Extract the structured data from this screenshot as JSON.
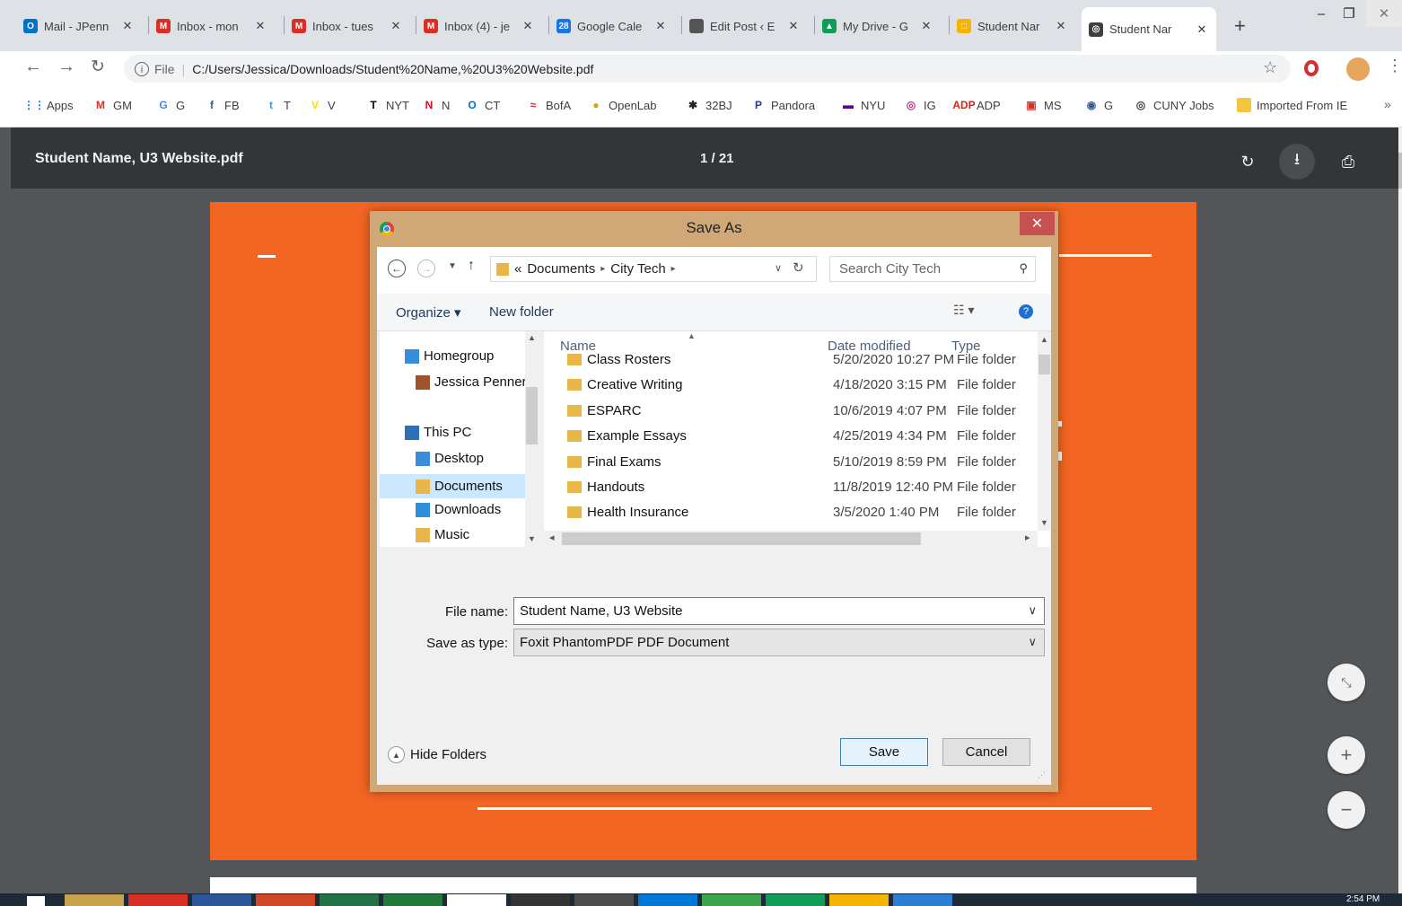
{
  "browser": {
    "tabs": [
      {
        "title": "Mail - JPenn",
        "icon": "outlook-icon",
        "color": "#0072c6",
        "letter": "O"
      },
      {
        "title": "Inbox - mon",
        "icon": "gmail-icon",
        "color": "#d93025",
        "letter": "M"
      },
      {
        "title": "Inbox - tues",
        "icon": "gmail-icon",
        "color": "#d93025",
        "letter": "M"
      },
      {
        "title": "Inbox (4) - je",
        "icon": "gmail-icon",
        "color": "#d93025",
        "letter": "M"
      },
      {
        "title": "Google Cale",
        "icon": "calendar-icon",
        "color": "#1a73e8",
        "letter": "28"
      },
      {
        "title": "Edit Post ‹ E",
        "icon": "image-icon",
        "color": "#555555",
        "letter": ""
      },
      {
        "title": "My Drive - G",
        "icon": "drive-icon",
        "color": "#0f9d58",
        "letter": "▲"
      },
      {
        "title": "Student Nar",
        "icon": "slides-icon",
        "color": "#f4b400",
        "letter": "□"
      },
      {
        "title": "Student Nar",
        "icon": "globe-icon",
        "color": "#3c4043",
        "letter": "◎"
      }
    ],
    "close_glyph": "✕",
    "new_tab": "+",
    "window": {
      "minimize": "–",
      "restore": "❐",
      "close": "✕"
    },
    "url_scheme": "File",
    "url": "C:/Users/Jessica/Downloads/Student%20Name,%20U3%20Website.pdf",
    "bookmarks": [
      {
        "label": "Apps",
        "icon": "apps-grid-icon",
        "color": "#1a73e8",
        "glyph": "⋮⋮"
      },
      {
        "label": "GM",
        "icon": "gmail-icon",
        "color": "#d93025",
        "glyph": "M"
      },
      {
        "label": "G",
        "icon": "google-icon",
        "color": "#4285f4",
        "glyph": "G"
      },
      {
        "label": "FB",
        "icon": "facebook-icon",
        "color": "#3b5998",
        "glyph": "f"
      },
      {
        "label": "T",
        "icon": "twitter-icon",
        "color": "#1da1f2",
        "glyph": "t"
      },
      {
        "label": "V",
        "icon": "vice-icon",
        "color": "#f5e000",
        "glyph": "V"
      },
      {
        "label": "NYT",
        "icon": "nyt-icon",
        "color": "#000000",
        "glyph": "T"
      },
      {
        "label": "N",
        "icon": "netflix-icon",
        "color": "#e50914",
        "glyph": "N"
      },
      {
        "label": "CT",
        "icon": "outlook-icon",
        "color": "#0072c6",
        "glyph": "O"
      },
      {
        "label": "BofA",
        "icon": "bofa-icon",
        "color": "#e31837",
        "glyph": "≈"
      },
      {
        "label": "OpenLab",
        "icon": "openlab-icon",
        "color": "#d4a017",
        "glyph": "●"
      },
      {
        "label": "32BJ",
        "icon": "union-icon",
        "color": "#222222",
        "glyph": "✱"
      },
      {
        "label": "Pandora",
        "icon": "pandora-icon",
        "color": "#224099",
        "glyph": "P"
      },
      {
        "label": "NYU",
        "icon": "nyu-icon",
        "color": "#57068c",
        "glyph": "▬"
      },
      {
        "label": "IG",
        "icon": "instagram-icon",
        "color": "#c13584",
        "glyph": "◎"
      },
      {
        "label": "ADP",
        "icon": "adp-icon",
        "color": "#d0271d",
        "glyph": "ADP"
      },
      {
        "label": "MS",
        "icon": "ms-icon",
        "color": "#d93025",
        "glyph": "▣"
      },
      {
        "label": "G",
        "icon": "globe-icon",
        "color": "#3c5a99",
        "glyph": "◉"
      },
      {
        "label": "CUNY Jobs",
        "icon": "globe-icon",
        "color": "#3c4043",
        "glyph": "◎"
      },
      {
        "label": "Imported From IE",
        "icon": "folder-icon",
        "color": "#f4c542",
        "glyph": ""
      }
    ],
    "bookmarks_more": "»"
  },
  "pdf": {
    "title": "Student Name, U3 Website.pdf",
    "page_indicator": "1 / 21",
    "page_color": "#f26522"
  },
  "dialog": {
    "title": "Save As",
    "close": "✕",
    "breadcrumb": [
      "«",
      "Documents",
      "City Tech"
    ],
    "search_placeholder": "Search City Tech",
    "organize": "Organize ▾",
    "new_folder": "New folder",
    "nav": [
      {
        "label": "Homegroup",
        "icon": "homegroup-icon"
      },
      {
        "label": "Jessica Penner",
        "icon": "user-icon"
      },
      {
        "label": "This PC",
        "icon": "pc-icon"
      },
      {
        "label": "Desktop",
        "icon": "desktop-icon"
      },
      {
        "label": "Documents",
        "icon": "documents-icon"
      },
      {
        "label": "Downloads",
        "icon": "downloads-icon"
      },
      {
        "label": "Music",
        "icon": "music-icon"
      }
    ],
    "columns": {
      "name": "Name",
      "date": "Date modified",
      "type": "Type"
    },
    "files": [
      {
        "name": "Class Rosters",
        "date": "5/20/2020 10:27 PM",
        "type": "File folder"
      },
      {
        "name": "Creative Writing",
        "date": "4/18/2020 3:15 PM",
        "type": "File folder"
      },
      {
        "name": "ESPARC",
        "date": "10/6/2019 4:07 PM",
        "type": "File folder"
      },
      {
        "name": "Example Essays",
        "date": "4/25/2019 4:34 PM",
        "type": "File folder"
      },
      {
        "name": "Final Exams",
        "date": "5/10/2019 8:59 PM",
        "type": "File folder"
      },
      {
        "name": "Handouts",
        "date": "11/8/2019 12:40 PM",
        "type": "File folder"
      },
      {
        "name": "Health Insurance",
        "date": "3/5/2020 1:40 PM",
        "type": "File folder"
      }
    ],
    "file_name_label": "File name:",
    "file_name": "Student Name, U3 Website",
    "save_type_label": "Save as type:",
    "save_type": "Foxit PhantomPDF PDF Document",
    "hide_folders": "Hide Folders",
    "save": "Save",
    "cancel": "Cancel"
  },
  "taskbar": {
    "clock": "2:54 PM"
  }
}
